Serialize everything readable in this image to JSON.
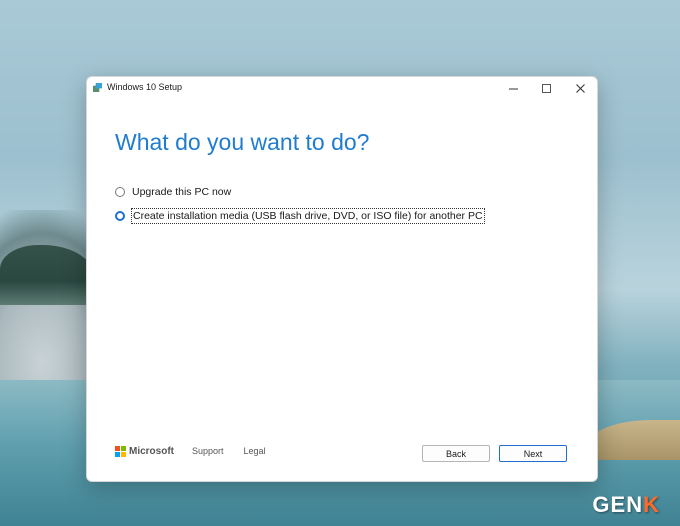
{
  "window": {
    "title": "Windows 10 Setup",
    "heading": "What do you want to do?"
  },
  "options": [
    {
      "label": "Upgrade this PC now",
      "selected": false
    },
    {
      "label": "Create installation media (USB flash drive, DVD, or ISO file) for another PC",
      "selected": true
    }
  ],
  "footer": {
    "brand": "Microsoft",
    "support_label": "Support",
    "legal_label": "Legal"
  },
  "buttons": {
    "back_label": "Back",
    "next_label": "Next"
  },
  "watermark": {
    "text_main": "GEN",
    "text_accent": "K"
  },
  "colors": {
    "accent": "#1f7ccf",
    "ms_red": "#f25022",
    "ms_green": "#7fba00",
    "ms_blue": "#00a4ef",
    "ms_yellow": "#ffb900"
  }
}
